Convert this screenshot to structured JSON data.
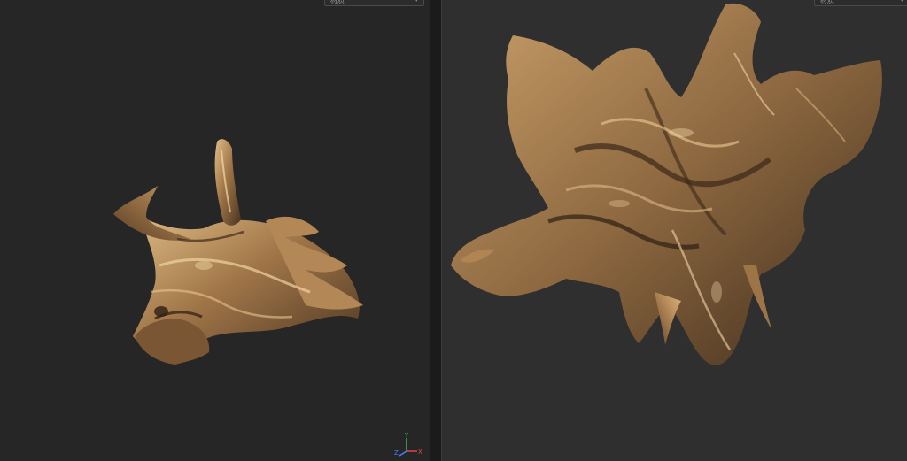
{
  "viewports": {
    "left": {
      "mode_dropdown": {
        "label": "材质"
      },
      "gizmo": {
        "x_label": "X",
        "y_label": "Y",
        "z_label": "Z"
      }
    },
    "right": {
      "mode_dropdown": {
        "label": "材质"
      }
    }
  },
  "colors": {
    "left_bg": "#262626",
    "right_bg": "#2f2f2f",
    "bronze_light": "#d9b27a",
    "bronze_mid": "#9a7248",
    "bronze_dark": "#4a3320",
    "axis_x": "#e5484d",
    "axis_y": "#3fbf5a",
    "axis_z": "#4a7dff"
  },
  "icons": [
    "chevron-down-icon",
    "axis-gizmo-icon"
  ]
}
